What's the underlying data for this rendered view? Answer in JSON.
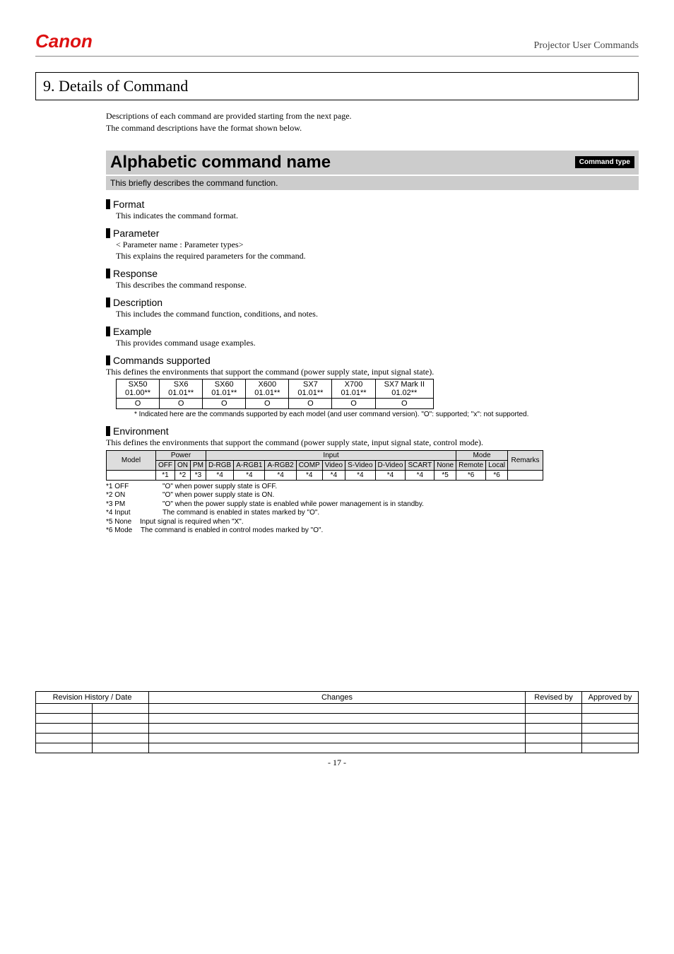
{
  "header": {
    "doc_title": "Projector User Commands"
  },
  "section": {
    "number_title": "9. Details of Command",
    "intro_line1": "Descriptions of each command are provided starting from the next page.",
    "intro_line2": "The command descriptions have the format shown below."
  },
  "cmd": {
    "name": "Alphabetic command name",
    "type_badge": "Command type",
    "brief": "This briefly describes the command function.",
    "format": {
      "hd": "Format",
      "body": "This indicates the command format."
    },
    "parameter": {
      "hd": "Parameter",
      "l1": "< Parameter name : Parameter types>",
      "l2": "This explains the required parameters for the command."
    },
    "response": {
      "hd": "Response",
      "body": "This describes the command response."
    },
    "description": {
      "hd": "Description",
      "body": "This includes the command function, conditions, and notes."
    },
    "example": {
      "hd": "Example",
      "body": "This provides command usage examples."
    },
    "supported": {
      "hd": "Commands supported",
      "body": "This defines the environments that support the command (power supply state, input signal state).",
      "models": [
        {
          "name": "SX50",
          "ver": "01.00**",
          "val": "O"
        },
        {
          "name": "SX6",
          "ver": "01.01**",
          "val": "O"
        },
        {
          "name": "SX60",
          "ver": "01.01**",
          "val": "O"
        },
        {
          "name": "X600",
          "ver": "01.01**",
          "val": "O"
        },
        {
          "name": "SX7",
          "ver": "01.01**",
          "val": "O"
        },
        {
          "name": "X700",
          "ver": "01.01**",
          "val": "O"
        },
        {
          "name": "SX7 Mark II",
          "ver": "01.02**",
          "val": "O"
        }
      ],
      "note": "* Indicated here are the commands supported by each model (and user command version). \"O\": supported; \"x\": not supported."
    },
    "environment": {
      "hd": "Environment",
      "body": "This defines the environments that support the command (power supply state, input signal state, control mode).",
      "hdr_model": "Model",
      "hdr_power": "Power",
      "hdr_input": "Input",
      "hdr_mode": "Mode",
      "hdr_remarks": "Remarks",
      "sub": {
        "off": "OFF",
        "on": "ON",
        "pm": "PM",
        "drgb": "D-RGB",
        "argb1": "A-RGB1",
        "argb2": "A-RGB2",
        "comp": "COMP",
        "video": "Video",
        "svideo": "S-Video",
        "dvideo": "D-Video",
        "scart": "SCART",
        "none": "None",
        "remote": "Remote",
        "local": "Local"
      },
      "vals": {
        "off": "*1",
        "on": "*2",
        "pm": "*3",
        "drgb": "*4",
        "argb1": "*4",
        "argb2": "*4",
        "comp": "*4",
        "video": "*4",
        "svideo": "*4",
        "dvideo": "*4",
        "scart": "*4",
        "none": "*5",
        "remote": "*6",
        "local": "*6"
      },
      "fn": [
        {
          "k": "*1 OFF",
          "v": "\"O\" when power supply state is OFF."
        },
        {
          "k": "*2 ON",
          "v": "\"O\" when power supply state is ON."
        },
        {
          "k": "*3 PM",
          "v": "\"O\" when the power supply state is enabled while power management is in standby."
        },
        {
          "k": "*4 Input",
          "v": "The command is enabled in states marked by \"O\"."
        },
        {
          "k": "*5 None",
          "v": "Input signal is required when \"X\"."
        },
        {
          "k": "*6 Mode",
          "v": "The command is enabled in control modes marked by \"O\"."
        }
      ]
    }
  },
  "rev": {
    "h1": "Revision History / Date",
    "h2": "Changes",
    "h3": "Revised by",
    "h4": "Approved by"
  },
  "page_number": "- 17 -"
}
